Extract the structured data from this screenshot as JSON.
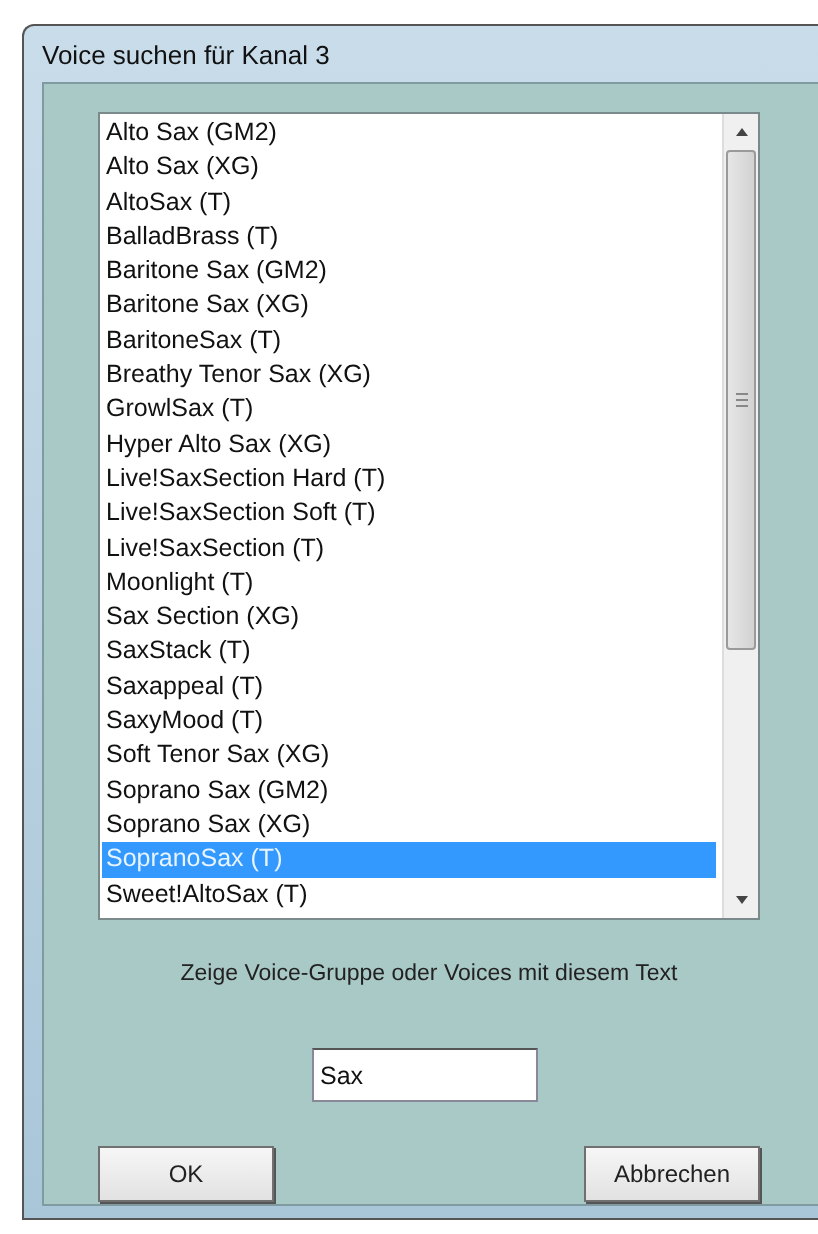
{
  "window": {
    "title": "Voice suchen für Kanal 3"
  },
  "voices": [
    {
      "label": "Alto Sax (GM2)",
      "selected": false
    },
    {
      "label": "Alto Sax (XG)",
      "selected": false
    },
    {
      "label": "AltoSax (T)",
      "selected": false
    },
    {
      "label": "BalladBrass (T)",
      "selected": false
    },
    {
      "label": "Baritone Sax (GM2)",
      "selected": false
    },
    {
      "label": "Baritone Sax (XG)",
      "selected": false
    },
    {
      "label": "BaritoneSax (T)",
      "selected": false
    },
    {
      "label": "Breathy Tenor Sax (XG)",
      "selected": false
    },
    {
      "label": "GrowlSax (T)",
      "selected": false
    },
    {
      "label": "Hyper Alto Sax (XG)",
      "selected": false
    },
    {
      "label": "Live!SaxSection Hard (T)",
      "selected": false
    },
    {
      "label": "Live!SaxSection Soft (T)",
      "selected": false
    },
    {
      "label": "Live!SaxSection (T)",
      "selected": false
    },
    {
      "label": "Moonlight (T)",
      "selected": false
    },
    {
      "label": "Sax Section (XG)",
      "selected": false
    },
    {
      "label": "SaxStack (T)",
      "selected": false
    },
    {
      "label": "Saxappeal (T)",
      "selected": false
    },
    {
      "label": "SaxyMood (T)",
      "selected": false
    },
    {
      "label": "Soft Tenor Sax (XG)",
      "selected": false
    },
    {
      "label": "Soprano Sax (GM2)",
      "selected": false
    },
    {
      "label": "Soprano Sax (XG)",
      "selected": false
    },
    {
      "label": "SopranoSax (T)",
      "selected": true
    },
    {
      "label": "Sweet!AltoSax (T)",
      "selected": false
    }
  ],
  "filter": {
    "label": "Zeige Voice-Gruppe oder Voices mit diesem Text",
    "value": "Sax"
  },
  "buttons": [
    "OK",
    "Abbrechen"
  ]
}
